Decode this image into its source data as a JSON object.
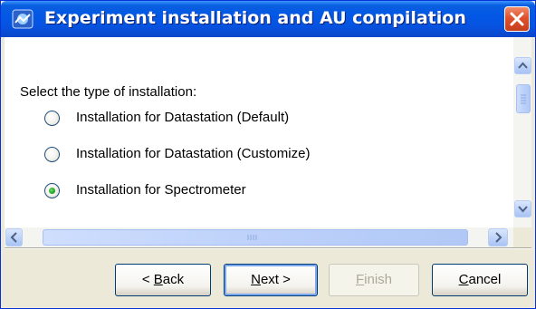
{
  "window": {
    "title": "Experiment installation and AU compilation",
    "title_bar_color": "#0358e6",
    "close_icon": "close-icon"
  },
  "content": {
    "prompt": "Select the type of installation:",
    "options": [
      {
        "label": "Installation for Datastation (Default)",
        "selected": false
      },
      {
        "label": "Installation for Datastation (Customize)",
        "selected": false
      },
      {
        "label": "Installation for Spectrometer",
        "selected": true
      }
    ]
  },
  "buttons": {
    "back": {
      "label": "< Back",
      "mnemonic": "B"
    },
    "next": {
      "label": "Next >",
      "mnemonic": "N"
    },
    "finish": {
      "label": "Finish",
      "mnemonic": "F",
      "enabled": false
    },
    "cancel": {
      "label": "Cancel",
      "mnemonic": "C"
    }
  }
}
